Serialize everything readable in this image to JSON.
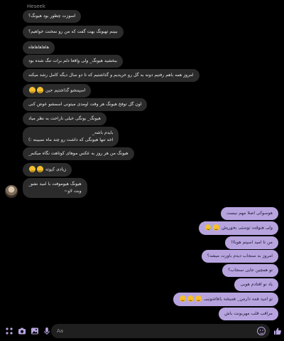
{
  "header": {
    "sender_name": "Heseek"
  },
  "incoming": [
    {
      "text": "اسوزت چطور بود هیونگ؟"
    },
    {
      "text": "ببینم تهیونگ بهت گفت که من رو نمخنت خواهیم؟"
    },
    {
      "text": "هاهاهاهاهاه"
    },
    {
      "text": "ببخشید هیونگ_ ولی واقعا دلم برات تنگ شده بود"
    },
    {
      "text": "امروز همه باهم رفتیم دونه به گل رو خریدیم و گذاشتیم که تا دو سال دیگه کامل رشد میکنه"
    },
    {
      "text": "اسپمشو گذاشتیم جین"
    },
    {
      "text": "اون گل توفخ هیونگ هر وقت اومدی میتونی اسمشو عوض کنی"
    },
    {
      "text": "هیونگ_ یونگی خیلی ناراحت به نظر میاد"
    },
    {
      "text": "بایدم باشه_\nاخه تنها هیونگی که داشت رو چند ماه نمیبینه :)"
    },
    {
      "text": "هیونگ من هر روز به عکس موهای کوتاهت نگاه میکنم_"
    },
    {
      "text": "زیادی کیوته"
    },
    {
      "text": "هیونگ هیوموفت با امید نشو_\nوبت لاو~"
    }
  ],
  "outgoing": [
    {
      "text": "هوسوکی اصلا مهم نیست"
    },
    {
      "text": "ولی هنوقت توستی بخوریش"
    },
    {
      "text": "من تا امید اسپتم هوباا!"
    },
    {
      "text": "امروز به سنجاب دیدم باورت میشه؟"
    },
    {
      "text": "تو همچین جایی سنجاب؟"
    },
    {
      "text": "یاد تو افتادم هوبی"
    },
    {
      "text": "تو امید همه دارمن_ همیشه باهاشونیی"
    },
    {
      "text": "مراقب قلب مهربونت باش"
    }
  ],
  "composer": {
    "placeholder": "Aa"
  },
  "icons": {
    "apps": "grid-icon",
    "camera": "camera-icon",
    "gallery": "image-icon",
    "mic": "microphone-icon",
    "emoji": "smiley-icon",
    "like": "thumbs-up-icon"
  },
  "colors": {
    "incoming_bubble": "#2b2b2b",
    "outgoing_bubble": "#b7a4df",
    "accent": "#b7a4df",
    "background": "#000000"
  }
}
